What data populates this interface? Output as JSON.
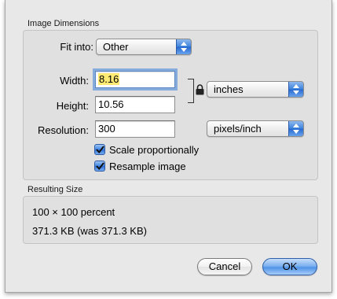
{
  "dimensions": {
    "group_label": "Image Dimensions",
    "fit_into": {
      "label": "Fit into:",
      "value": "Other"
    },
    "width": {
      "label": "Width:",
      "value": "8.16"
    },
    "height": {
      "label": "Height:",
      "value": "10.56"
    },
    "units": {
      "value": "inches"
    },
    "resolution": {
      "label": "Resolution:",
      "value": "300",
      "units": "pixels/inch"
    },
    "scale_proportionally": {
      "label": "Scale proportionally",
      "checked": true
    },
    "resample_image": {
      "label": "Resample image",
      "checked": true
    }
  },
  "result": {
    "group_label": "Resulting Size",
    "size_line": "100 × 100 percent",
    "bytes_line": "371.3 KB (was 371.3 KB)"
  },
  "buttons": {
    "cancel": "Cancel",
    "ok": "OK"
  },
  "colors": {
    "accent": "#3c83dd",
    "highlight": "#ffeb73",
    "focus_ring": "#86acde"
  }
}
